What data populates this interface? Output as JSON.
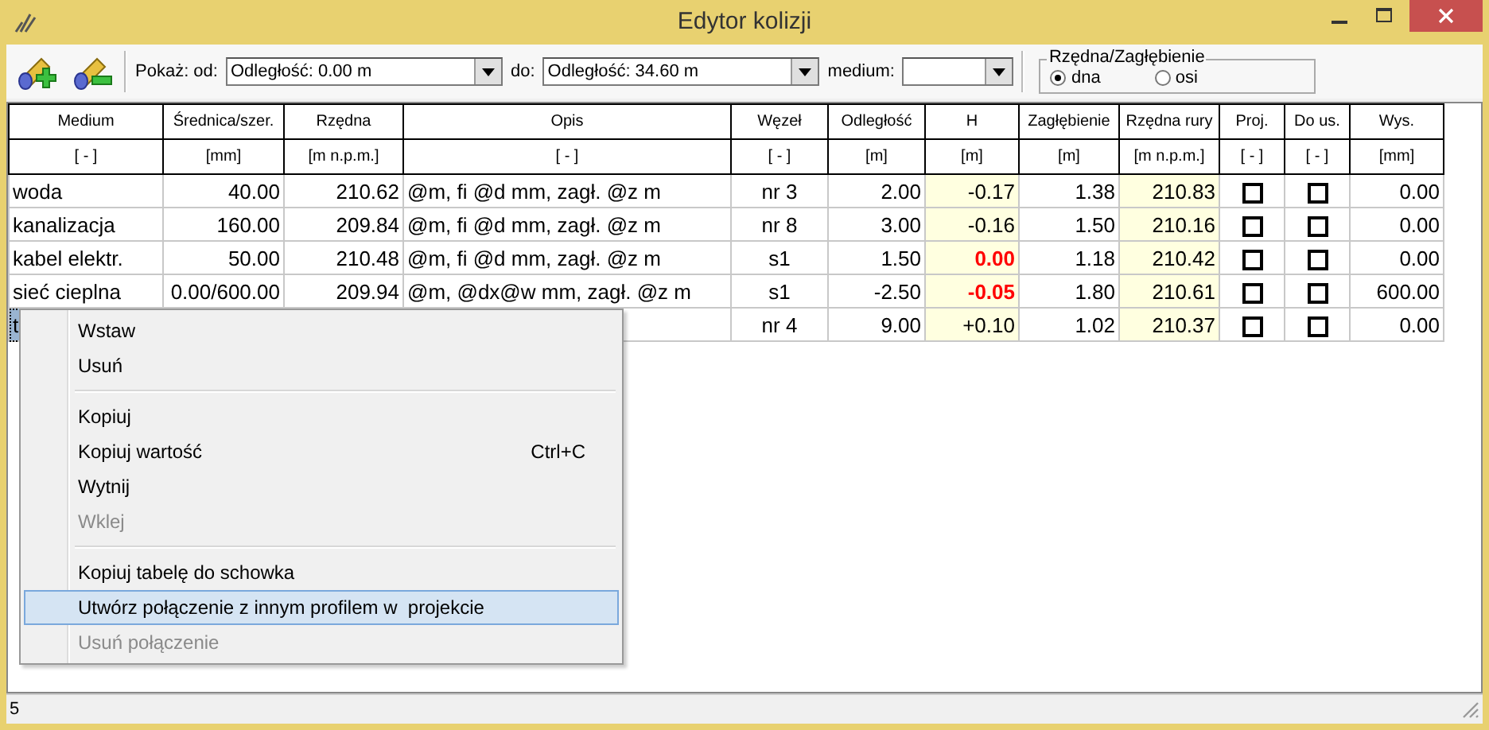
{
  "window": {
    "title": "Edytor kolizji"
  },
  "toolbar": {
    "show_from_label": "Pokaż: od:",
    "from_value": "Odległość: 0.00 m",
    "to_label": "do:",
    "to_value": "Odległość: 34.60 m",
    "medium_label": "medium:",
    "radio_group": {
      "title": "Rzędna/Zagłębienie",
      "options": [
        {
          "label": "dna",
          "selected": true
        },
        {
          "label": "osi",
          "selected": false
        }
      ]
    }
  },
  "table": {
    "columns": [
      {
        "title": "Medium",
        "unit": "[ - ]",
        "kind": "text"
      },
      {
        "title": "Średnica/szer.",
        "unit": "[mm]",
        "kind": "num"
      },
      {
        "title": "Rzędna",
        "unit": "[m n.p.m.]",
        "kind": "num"
      },
      {
        "title": "Opis",
        "unit": "[ - ]",
        "kind": "text"
      },
      {
        "title": "Węzeł",
        "unit": "[ - ]",
        "kind": "center"
      },
      {
        "title": "Odległość",
        "unit": "[m]",
        "kind": "num"
      },
      {
        "title": "H",
        "unit": "[m]",
        "kind": "highlight"
      },
      {
        "title": "Zagłębienie",
        "unit": "[m]",
        "kind": "num"
      },
      {
        "title": "Rzędna rury",
        "unit": "[m n.p.m.]",
        "kind": "highlight"
      },
      {
        "title": "Proj.",
        "unit": "[ - ]",
        "kind": "check"
      },
      {
        "title": "Do us.",
        "unit": "[ - ]",
        "kind": "check"
      },
      {
        "title": "Wys.",
        "unit": "[mm]",
        "kind": "num"
      }
    ],
    "rows": [
      {
        "selected": false,
        "cells": [
          {
            "text": "woda"
          },
          {
            "text": "40.00"
          },
          {
            "text": "210.62"
          },
          {
            "text": "@m, fi @d mm, zagł. @z m"
          },
          {
            "text": "nr 3"
          },
          {
            "text": "2.00"
          },
          {
            "text": "-0.17",
            "alert": false
          },
          {
            "text": "1.38"
          },
          {
            "text": "210.83"
          },
          {
            "checked": false
          },
          {
            "checked": false
          },
          {
            "text": "0.00"
          }
        ]
      },
      {
        "selected": false,
        "cells": [
          {
            "text": "kanalizacja"
          },
          {
            "text": "160.00"
          },
          {
            "text": "209.84"
          },
          {
            "text": "@m, fi @d mm, zagł. @z m"
          },
          {
            "text": "nr 8"
          },
          {
            "text": "3.00"
          },
          {
            "text": "-0.16",
            "alert": false
          },
          {
            "text": "1.50"
          },
          {
            "text": "210.16"
          },
          {
            "checked": false
          },
          {
            "checked": false
          },
          {
            "text": "0.00"
          }
        ]
      },
      {
        "selected": false,
        "cells": [
          {
            "text": "kabel elektr."
          },
          {
            "text": "50.00"
          },
          {
            "text": "210.48"
          },
          {
            "text": "@m, fi @d mm, zagł. @z m"
          },
          {
            "text": "s1"
          },
          {
            "text": "1.50"
          },
          {
            "text": "0.00",
            "alert": true
          },
          {
            "text": "1.18"
          },
          {
            "text": "210.42"
          },
          {
            "checked": false
          },
          {
            "checked": false
          },
          {
            "text": "0.00"
          }
        ]
      },
      {
        "selected": false,
        "cells": [
          {
            "text": "sieć cieplna"
          },
          {
            "text": "0.00/600.00"
          },
          {
            "text": "209.94"
          },
          {
            "text": "@m, @dx@w mm, zagł. @z m"
          },
          {
            "text": "s1"
          },
          {
            "text": "-2.50"
          },
          {
            "text": "-0.05",
            "alert": true
          },
          {
            "text": "1.80"
          },
          {
            "text": "210.61"
          },
          {
            "checked": false
          },
          {
            "checked": false
          },
          {
            "text": "600.00"
          }
        ]
      },
      {
        "selected": true,
        "cells": [
          {
            "text": "t"
          },
          {},
          {},
          {},
          {
            "text": "nr 4"
          },
          {
            "text": "9.00"
          },
          {
            "text": "+0.10",
            "alert": false
          },
          {
            "text": "1.02"
          },
          {
            "text": "210.37"
          },
          {
            "checked": false
          },
          {
            "checked": false
          },
          {
            "text": "0.00"
          }
        ]
      }
    ]
  },
  "context_menu": {
    "items": [
      {
        "kind": "item",
        "label": "Wstaw",
        "disabled": false,
        "selected": false
      },
      {
        "kind": "item",
        "label": "Usuń",
        "disabled": false,
        "selected": false
      },
      {
        "kind": "separator"
      },
      {
        "kind": "item",
        "label": "Kopiuj",
        "disabled": false,
        "selected": false
      },
      {
        "kind": "item",
        "label": "Kopiuj wartość",
        "shortcut": "Ctrl+C",
        "disabled": false,
        "selected": false
      },
      {
        "kind": "item",
        "label": "Wytnij",
        "disabled": false,
        "selected": false
      },
      {
        "kind": "item",
        "label": "Wklej",
        "disabled": true,
        "selected": false
      },
      {
        "kind": "separator"
      },
      {
        "kind": "item",
        "label": "Kopiuj tabelę do schowka",
        "disabled": false,
        "selected": false
      },
      {
        "kind": "item",
        "label": "Utwórz połączenie z innym profilem w  projekcie",
        "disabled": false,
        "selected": true
      },
      {
        "kind": "item",
        "label": "Usuń połączenie",
        "disabled": true,
        "selected": false
      }
    ]
  },
  "status_bar": {
    "text": "5"
  }
}
